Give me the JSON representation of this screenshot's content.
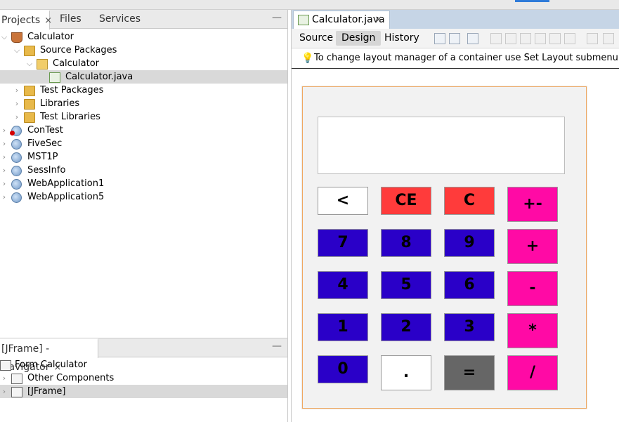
{
  "projects_panel": {
    "tabs": [
      {
        "label": "Projects",
        "close": "×"
      },
      {
        "label": "Files"
      },
      {
        "label": "Services"
      }
    ],
    "minimize": "—",
    "tree": [
      {
        "label": "Calculator",
        "icon": "coffee-cup-icon",
        "expanded": true
      },
      {
        "label": "Source Packages",
        "icon": "folder-icon",
        "expanded": true
      },
      {
        "label": "Calculator",
        "icon": "package-icon",
        "expanded": true
      },
      {
        "label": "Calculator.java",
        "icon": "java-form-file-icon",
        "selected": true
      },
      {
        "label": "Test Packages",
        "icon": "folder-icon"
      },
      {
        "label": "Libraries",
        "icon": "library-icon"
      },
      {
        "label": "Test Libraries",
        "icon": "library-icon"
      },
      {
        "label": "ConTest",
        "icon": "globe-icon",
        "error": true
      },
      {
        "label": "FiveSec",
        "icon": "globe-icon"
      },
      {
        "label": "MST1P",
        "icon": "globe-icon"
      },
      {
        "label": "SessInfo",
        "icon": "globe-icon"
      },
      {
        "label": "WebApplication1",
        "icon": "globe-icon"
      },
      {
        "label": "WebApplication5",
        "icon": "globe-icon"
      }
    ]
  },
  "navigator_panel": {
    "title": "[JFrame] - Navigator",
    "close": "×",
    "minimize": "—",
    "tree": [
      {
        "label": "Form Calculator",
        "icon": "form-icon"
      },
      {
        "label": "Other Components",
        "icon": "components-icon"
      },
      {
        "label": "[JFrame]",
        "icon": "jframe-icon",
        "selected": true
      }
    ]
  },
  "editor": {
    "tab_label": "Calculator.java",
    "tab_close": "×",
    "views": [
      {
        "label": "Source"
      },
      {
        "label": "Design",
        "active": true
      },
      {
        "label": "History"
      }
    ],
    "hint": "To change layout manager of a container use Set Layout submenu from its"
  },
  "calculator": {
    "display_value": "",
    "buttons": [
      {
        "label": "<",
        "color": "#ffffff"
      },
      {
        "label": "CE",
        "color": "#ff3b3b"
      },
      {
        "label": "C",
        "color": "#ff3b3b"
      },
      {
        "label": "+-",
        "color": "#ff0aa5"
      },
      {
        "label": "7",
        "color": "#2a00c8"
      },
      {
        "label": "8",
        "color": "#2a00c8"
      },
      {
        "label": "9",
        "color": "#2a00c8"
      },
      {
        "label": "+",
        "color": "#ff0aa5"
      },
      {
        "label": "4",
        "color": "#2a00c8"
      },
      {
        "label": "5",
        "color": "#2a00c8"
      },
      {
        "label": "6",
        "color": "#2a00c8"
      },
      {
        "label": "-",
        "color": "#ff0aa5"
      },
      {
        "label": "1",
        "color": "#2a00c8"
      },
      {
        "label": "2",
        "color": "#2a00c8"
      },
      {
        "label": "3",
        "color": "#2a00c8"
      },
      {
        "label": "*",
        "color": "#ff0aa5"
      },
      {
        "label": "0",
        "color": "#2a00c8"
      },
      {
        "label": ".",
        "color": "#ffffff"
      },
      {
        "label": "=",
        "color": "#666666"
      },
      {
        "label": "/",
        "color": "#ff0aa5"
      }
    ]
  }
}
